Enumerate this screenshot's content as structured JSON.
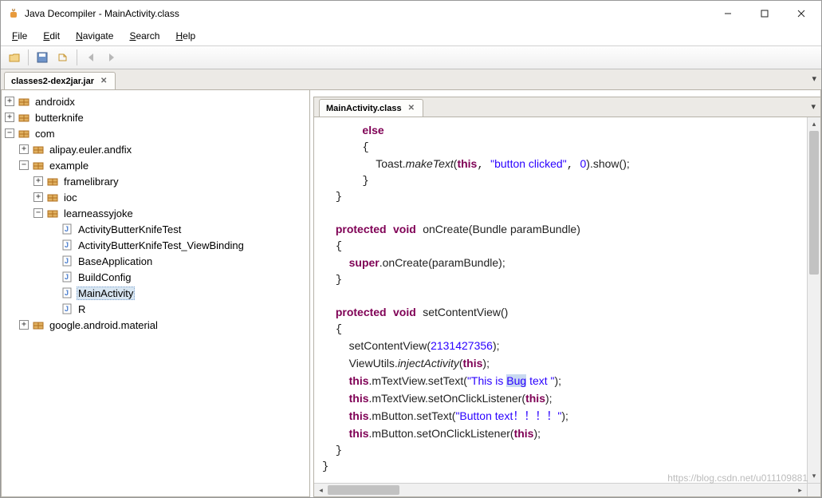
{
  "window": {
    "title": "Java Decompiler - MainActivity.class"
  },
  "menubar": {
    "file": "File",
    "edit": "Edit",
    "navigate": "Navigate",
    "search": "Search",
    "help": "Help"
  },
  "maintab": {
    "label": "classes2-dex2jar.jar"
  },
  "tree": {
    "androidx": "androidx",
    "butterknife": "butterknife",
    "com": "com",
    "alipay": "alipay.euler.andfix",
    "example": "example",
    "framelibrary": "framelibrary",
    "ioc": "ioc",
    "learneassyjoke": "learneassyjoke",
    "c1": "ActivityButterKnifeTest",
    "c2": "ActivityButterKnifeTest_ViewBinding",
    "c3": "BaseApplication",
    "c4": "BuildConfig",
    "c5": "MainActivity",
    "c6": "R",
    "google": "google.android.material"
  },
  "editor_tab": {
    "label": "MainActivity.class"
  },
  "code": {
    "kw_else": "else",
    "toast_pre": "Toast.",
    "toast_call": "makeText",
    "toast_open": "(",
    "kw_this": "this",
    "toast_str": "\"button clicked\"",
    "toast_num": "0",
    "toast_tail": ").show();",
    "kw_protected": "protected",
    "kw_void": "void",
    "m_onCreate": "onCreate",
    "onCreate_sig": "(Bundle paramBundle)",
    "kw_super": "super",
    "onCreate_body": ".onCreate(paramBundle);",
    "m_setCV": "setContentView",
    "setCV_sig": "()",
    "scv_call": "setContentView(",
    "scv_num": "2131427356",
    "scv_tail": ");",
    "vu_pre": "ViewUtils.",
    "vu_call": "injectActivity",
    "vu_tail": "(",
    "vu_tail2": ");",
    "tv1_a": ".mTextView.setText(",
    "tv1_str_a": "\"This is ",
    "tv1_hl": "Bug",
    "tv1_str_b": " text \"",
    "tv1_tail": ");",
    "tv2_a": ".mTextView.setOnClickListener(",
    "tv2_tail": ");",
    "bt1_a": ".mButton.setText(",
    "bt1_str": "\"Button text！！！！\"",
    "bt1_tail": ");",
    "bt2_a": ".mButton.setOnClickListener(",
    "bt2_tail": ");"
  },
  "watermark": "https://blog.csdn.net/u011109881"
}
